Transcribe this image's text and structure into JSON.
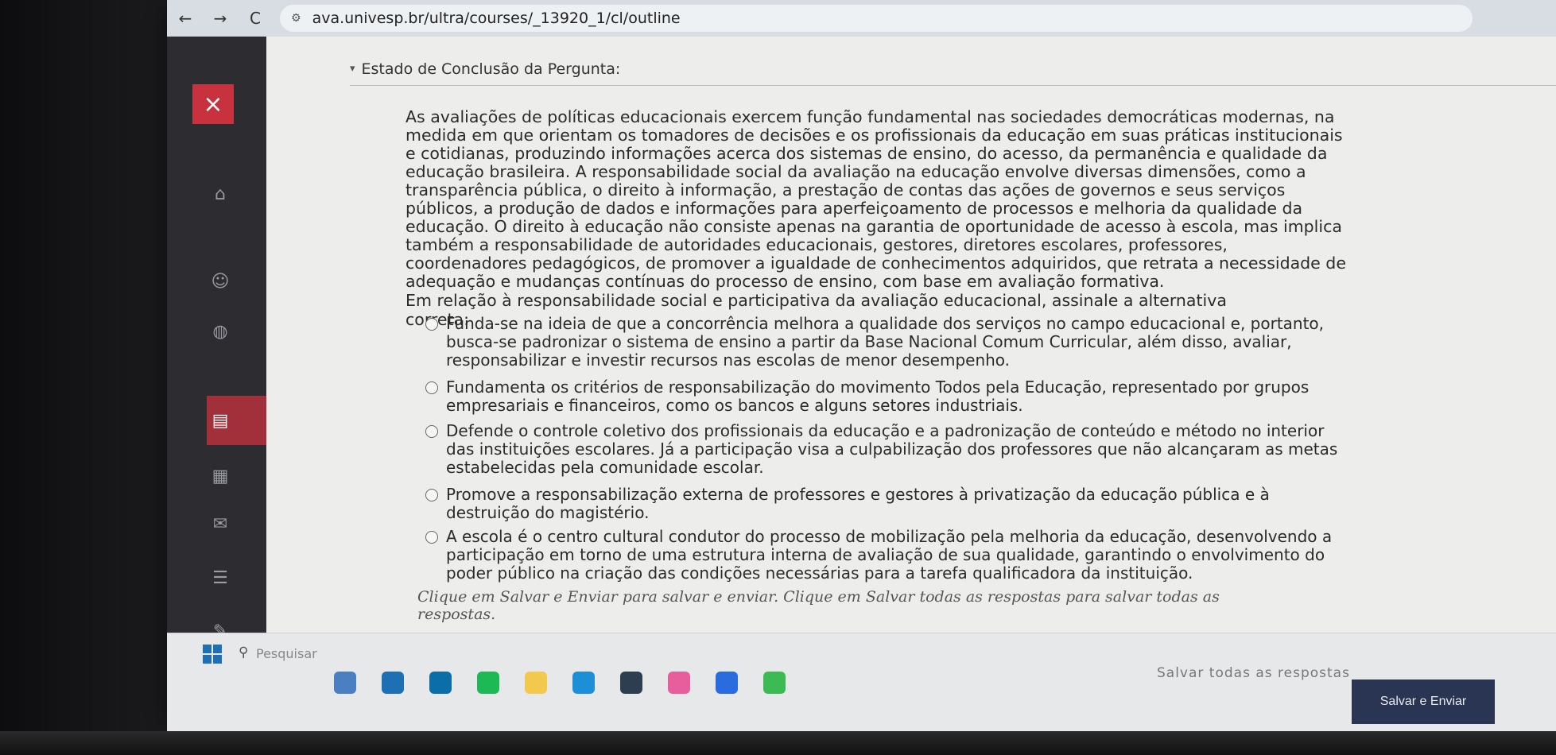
{
  "browser": {
    "url": "ava.univesp.br/ultra/courses/_13920_1/cl/outline",
    "back_icon": "←",
    "forward_icon": "→",
    "reload_icon": "C"
  },
  "sidebar": {
    "close_icon": "×",
    "icons": [
      "institution-icon",
      "profile-icon",
      "globe-icon",
      "courses-icon",
      "calendar-icon",
      "messages-icon",
      "grades-icon",
      "edit-icon"
    ]
  },
  "header": {
    "status_label": "Estado de Conclusão da Pergunta:"
  },
  "question": {
    "text": "As avaliações de políticas educacionais exercem função fundamental nas sociedades democráticas modernas, na medida em que orientam os tomadores de decisões e os profissionais da educação em suas práticas institucionais e cotidianas, produzindo informações acerca dos sistemas de ensino, do acesso, da permanência e qualidade da educação brasileira. A responsabilidade social da avaliação na educação envolve diversas dimensões, como a transparência pública, o direito à informação, a prestação de contas das ações de governos e seus serviços públicos, a produção de dados e informações para aperfeiçoamento de processos e melhoria da qualidade da educação. O direito à educação não consiste apenas na garantia de oportunidade de acesso à escola, mas implica também a responsabilidade de autoridades educacionais, gestores, diretores escolares, professores, coordenadores pedagógicos, de promover a igualdade de conhecimentos adquiridos, que retrata a necessidade de adequação e mudanças contínuas do processo de ensino, com base em avaliação formativa.",
    "prompt": "Em relação à responsabilidade social e participativa da avaliação educacional, assinale a alternativa correta:",
    "options": [
      "Funda-se na ideia de que a concorrência melhora a qualidade dos serviços no campo educacional e, portanto, busca-se padronizar o sistema de ensino a partir da Base Nacional Comum Curricular, além disso, avaliar, responsabilizar e investir recursos nas escolas de menor desempenho.",
      "Fundamenta os critérios de responsabilização do movimento Todos pela Educação, representado por grupos empresariais e financeiros, como os bancos e alguns setores industriais.",
      "Defende o controle coletivo dos profissionais da educação e a padronização de conteúdo e método no interior das instituições escolares. Já a participação visa a culpabilização dos professores que não alcançaram as metas estabelecidas pela comunidade escolar.",
      "Promove a responsabilização externa de professores e gestores à privatização da educação pública e à destruição do magistério.",
      "A escola é o centro cultural condutor do processo de mobilização pela melhoria da educação, desenvolvendo a participação em torno de uma estrutura interna de avaliação de sua qualidade, garantindo o envolvimento do poder público na criação das condições necessárias para a tarefa qualificadora da instituição."
    ]
  },
  "footer": {
    "note": "Clique em Salvar e Enviar para salvar e enviar. Clique em Salvar todas as respostas para salvar todas as respostas.",
    "save_all_label": "Salvar todas as respostas",
    "submit_label": "Salvar e Enviar"
  },
  "taskbar": {
    "search_placeholder": "Pesquisar",
    "app_colors": [
      "#4a7fc1",
      "#1f6fb5",
      "#0b6ea8",
      "#1db954",
      "#f2c94c",
      "#1d8fd8",
      "#2c3e50",
      "#e85d9c",
      "#2a6be0",
      "#3cba54"
    ]
  },
  "colors": {
    "accent_red": "#c8313e",
    "submit_bg": "#2a3554"
  }
}
